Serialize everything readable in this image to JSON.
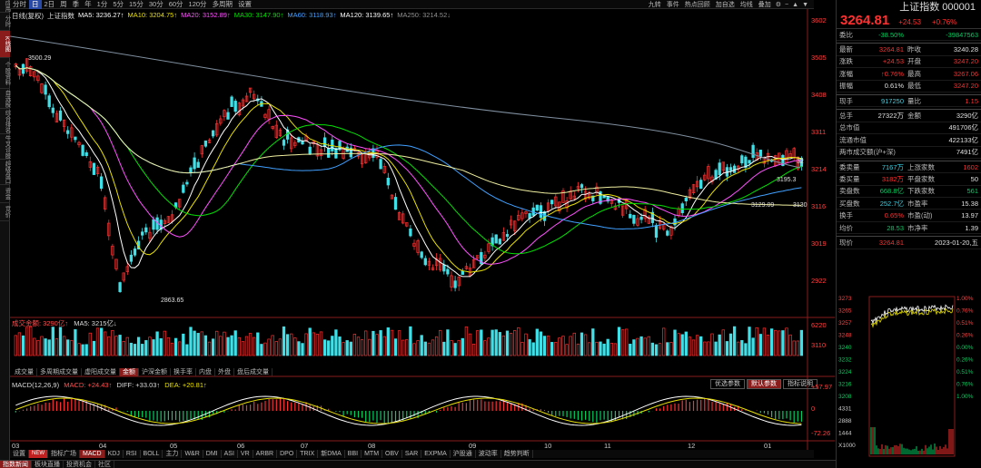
{
  "left_tabs": [
    "应用",
    "分时",
    "K线图",
    "个股资料",
    "自选股",
    "综合排名",
    "牛叉诊股",
    "超级盘口",
    "资金",
    "竞价"
  ],
  "left_tab_active": 2,
  "toolbar": {
    "periods": [
      "分时",
      "日",
      "2日",
      "周",
      "季",
      "年",
      "1分",
      "5分",
      "15分",
      "30分",
      "60分",
      "120分",
      "多周期",
      "设置"
    ],
    "active_period": 1,
    "right_items": [
      "九转",
      "事件",
      "热点回顾",
      "加自选",
      "均线",
      "叠加"
    ]
  },
  "ma_legend": {
    "title": "日线(复权)",
    "name": "上证指数",
    "items": [
      {
        "text": "MA5: 3236.27↑",
        "color": "#ffffff"
      },
      {
        "text": "MA10: 3204.75↑",
        "color": "#e8e000"
      },
      {
        "text": "MA20: 3152.89↑",
        "color": "#ff50ff"
      },
      {
        "text": "MA30: 3147.90↑",
        "color": "#00e000"
      },
      {
        "text": "MA60: 3118.93↑",
        "color": "#40a0ff"
      },
      {
        "text": "MA120: 3139.65↑",
        "color": "#ffffff"
      },
      {
        "text": "MA250: 3214.52↓",
        "color": "#909090"
      }
    ]
  },
  "price_axis": [
    "3602",
    "3505",
    "3408",
    "3311",
    "3214",
    "3116",
    "3019",
    "2922"
  ],
  "date_axis": [
    "03",
    "04",
    "05",
    "06",
    "07",
    "08",
    "09",
    "10",
    "11",
    "12",
    "01"
  ],
  "annotations": {
    "high": "3500.29",
    "low": "2863.65",
    "right1": "3195.3",
    "right2": "3129.09",
    "right3": "3130",
    "right4": "32"
  },
  "volume": {
    "legend_label": "成交金额: 3290亿↑",
    "legend_ma": "MA5: 3215亿↓",
    "axis": [
      "6220",
      "3110"
    ],
    "tabs": [
      "成交量",
      "多周期成交量",
      "虚阳成交量",
      "金额",
      "沪深金额",
      "换手率",
      "内盘",
      "外盘",
      "盘后成交量"
    ],
    "active_tab": 3
  },
  "macd": {
    "legend_title": "MACD(12,26,9)",
    "macd": "MACD: +24.43↑",
    "diff": "DIFF: +33.03↑",
    "dea": "DEA: +20.81↑",
    "axis_top": "+57.97",
    "axis_zero": "0",
    "axis_bottom": "-72.26",
    "buttons": [
      "优选参数",
      "默认参数",
      "指标说明"
    ],
    "active_button": 1
  },
  "indicator_tabs": [
    "设置",
    "NEW",
    "指标广场",
    "MACD",
    "KDJ",
    "RSI",
    "BOLL",
    "主力",
    "W&R",
    "DMI",
    "ASI",
    "VR",
    "ARBR",
    "DPO",
    "TRIX",
    "新DMA",
    "BBI",
    "MTM",
    "OBV",
    "SAR",
    "EXPMA",
    "沪股通",
    "波动率",
    "趋势判断"
  ],
  "indicator_active": 3,
  "status_tabs": [
    "指数新闻",
    "板块直播",
    "投资机会",
    "社区"
  ],
  "status_active": 0,
  "right_panel": {
    "title": "上证指数 000001",
    "price": "3264.81",
    "change": "+24.53",
    "change_pct": "+0.76%",
    "rows": [
      {
        "k1": "委比",
        "v1": "-38.50%",
        "c1": "green",
        "k2": "",
        "v2": "-39847563",
        "c2": "green"
      },
      {
        "k1": "最新",
        "v1": "3264.81",
        "c1": "red",
        "k2": "昨收",
        "v2": "3240.28",
        "c2": "white"
      },
      {
        "k1": "涨跌",
        "v1": "+24.53",
        "c1": "red",
        "k2": "开盘",
        "v2": "3247.20",
        "c2": "red"
      },
      {
        "k1": "涨幅",
        "v1": "↑0.76%",
        "c1": "red",
        "k2": "最高",
        "v2": "3267.06",
        "c2": "red"
      },
      {
        "k1": "振幅",
        "v1": "0.61%",
        "c1": "white",
        "k2": "最低",
        "v2": "3247.20",
        "c2": "red"
      },
      {
        "k1": "现手",
        "v1": "917250",
        "c1": "cyan",
        "k2": "量比",
        "v2": "1.15",
        "c2": "red"
      },
      {
        "k1": "总手",
        "v1": "27322万",
        "c1": "white",
        "k2": "金额",
        "v2": "3290亿",
        "c2": "white"
      }
    ],
    "rows_wide": [
      {
        "k": "总市值",
        "v": "491706亿"
      },
      {
        "k": "流通市值",
        "v": "422133亿"
      },
      {
        "k": "两市成交额(沪+深)",
        "v": "7491亿"
      }
    ],
    "rows2": [
      {
        "k1": "委卖量",
        "v1": "7167万",
        "c1": "cyan",
        "k2": "上涨家数",
        "v2": "1602",
        "c2": "red"
      },
      {
        "k1": "委买量",
        "v1": "3182万",
        "c1": "red",
        "k2": "平盘家数",
        "v2": "50",
        "c2": "white"
      },
      {
        "k1": "卖盘数",
        "v1": "668.8亿",
        "c1": "green",
        "k2": "下跌家数",
        "v2": "561",
        "c2": "green"
      },
      {
        "k1": "买盘数",
        "v1": "252.7亿",
        "c1": "cyan",
        "k2": "市盈率",
        "v2": "15.38",
        "c2": "white"
      },
      {
        "k1": "换手",
        "v1": "0.65%",
        "c1": "red",
        "k2": "市盈(动)",
        "v2": "13.97",
        "c2": "white"
      },
      {
        "k1": "均价",
        "v1": "28.53",
        "c1": "green",
        "k2": "市净率",
        "v2": "1.39",
        "c2": "white"
      }
    ],
    "price_row": {
      "k": "现价",
      "v": "3264.81",
      "date": "2023-01-20,五"
    },
    "mini_left_axis": [
      "3273",
      "3265",
      "3257",
      "3248",
      "3240",
      "3232",
      "3224",
      "3216",
      "3208",
      "4331",
      "2888",
      "1444",
      "X1000"
    ],
    "mini_right_axis": [
      "1.00%",
      "0.76%",
      "0.51%",
      "0.26%",
      "0.00%",
      "0.26%",
      "0.51%",
      "0.76%",
      "1.00%"
    ]
  }
}
